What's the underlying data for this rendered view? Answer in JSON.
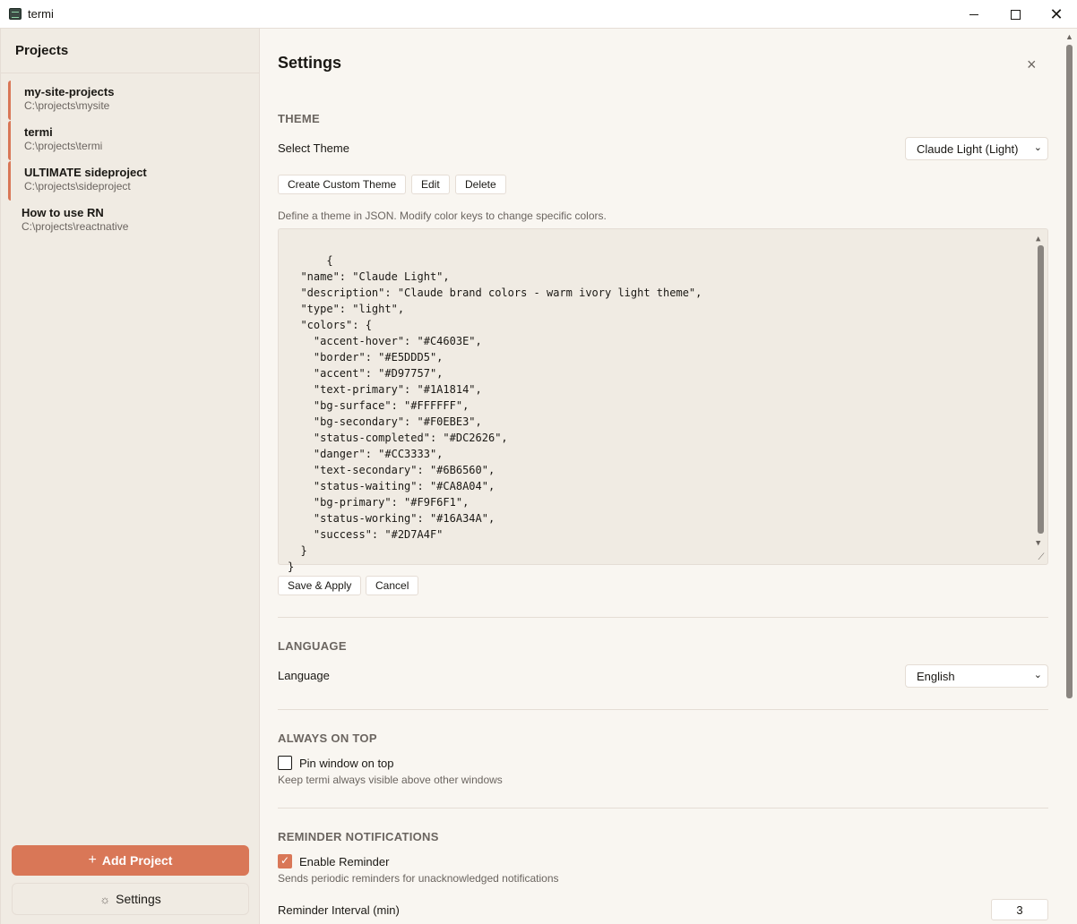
{
  "window": {
    "title": "termi"
  },
  "sidebar": {
    "header": "Projects",
    "projects": [
      {
        "name": "my-site-projects",
        "path": "C:\\projects\\mysite",
        "active": true
      },
      {
        "name": "termi",
        "path": "C:\\projects\\termi",
        "active": true
      },
      {
        "name": "ULTIMATE sideproject",
        "path": "C:\\projects\\sideproject",
        "active": true
      },
      {
        "name": "How to use RN",
        "path": "C:\\projects\\reactnative",
        "active": false
      }
    ],
    "add_project_label": "Add Project",
    "add_project_icon": "+",
    "settings_label": "Settings"
  },
  "settings": {
    "title": "Settings",
    "close_icon": "×",
    "theme": {
      "section": "THEME",
      "select_label": "Select Theme",
      "selected": "Claude Light (Light)",
      "buttons": {
        "create": "Create Custom Theme",
        "edit": "Edit",
        "delete": "Delete"
      },
      "hint": "Define a theme in JSON. Modify color keys to change specific colors.",
      "json": "{\n  \"name\": \"Claude Light\",\n  \"description\": \"Claude brand colors - warm ivory light theme\",\n  \"type\": \"light\",\n  \"colors\": {\n    \"accent-hover\": \"#C4603E\",\n    \"border\": \"#E5DDD5\",\n    \"accent\": \"#D97757\",\n    \"text-primary\": \"#1A1814\",\n    \"bg-surface\": \"#FFFFFF\",\n    \"bg-secondary\": \"#F0EBE3\",\n    \"status-completed\": \"#DC2626\",\n    \"danger\": \"#CC3333\",\n    \"text-secondary\": \"#6B6560\",\n    \"status-waiting\": \"#CA8A04\",\n    \"bg-primary\": \"#F9F6F1\",\n    \"status-working\": \"#16A34A\",\n    \"success\": \"#2D7A4F\"\n  }\n}",
      "save_label": "Save & Apply",
      "cancel_label": "Cancel"
    },
    "language": {
      "section": "LANGUAGE",
      "label": "Language",
      "selected": "English"
    },
    "always_on_top": {
      "section": "ALWAYS ON TOP",
      "label": "Pin window on top",
      "checked": false,
      "hint": "Keep termi always visible above other windows"
    },
    "reminder": {
      "section": "REMINDER NOTIFICATIONS",
      "label": "Enable Reminder",
      "checked": true,
      "hint": "Sends periodic reminders for unacknowledged notifications",
      "interval_label": "Reminder Interval (min)",
      "interval_value": "3"
    }
  },
  "colors": {
    "accent": "#D97757",
    "bg_primary": "#F9F6F1",
    "bg_secondary": "#F0EBE3",
    "border": "#E5DDD5",
    "text_primary": "#1A1814",
    "text_secondary": "#6B6560"
  }
}
